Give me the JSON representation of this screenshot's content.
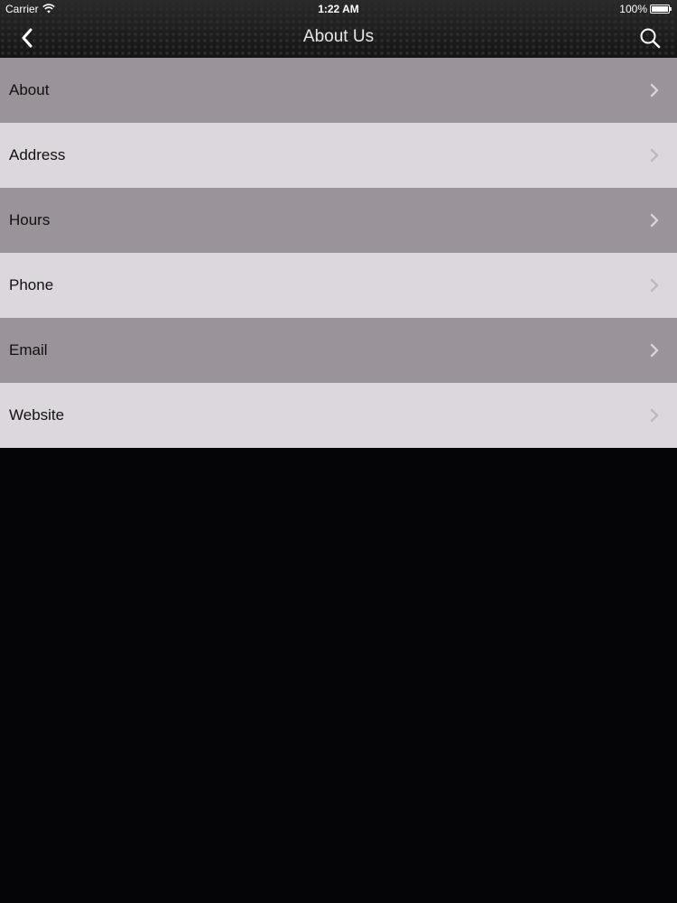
{
  "status_bar": {
    "carrier": "Carrier",
    "time": "1:22 AM",
    "battery": "100%"
  },
  "nav": {
    "title": "About Us",
    "back_icon": "chevron-left-icon",
    "search_icon": "search-icon"
  },
  "menu": {
    "items": [
      {
        "label": "About"
      },
      {
        "label": "Address"
      },
      {
        "label": "Hours"
      },
      {
        "label": "Phone"
      },
      {
        "label": "Email"
      },
      {
        "label": "Website"
      }
    ]
  },
  "colors": {
    "row_dark": "#9a9399",
    "row_light": "#dcd7dc",
    "background": "#050406",
    "nav_text": "#e6e6e6"
  }
}
